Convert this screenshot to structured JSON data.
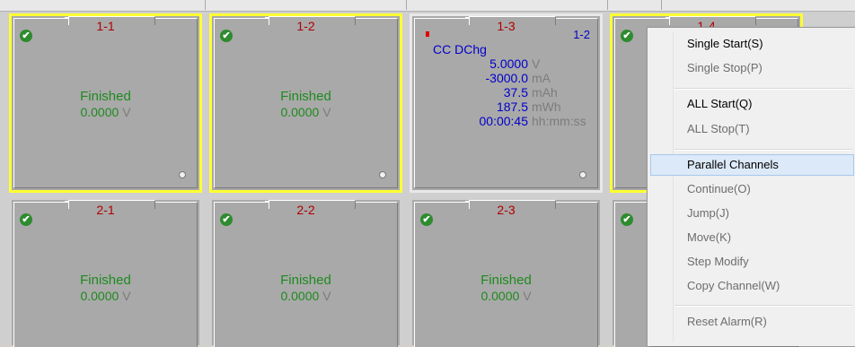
{
  "channels_row1": [
    {
      "id": "1-1",
      "status": "Finished",
      "voltage": "0.0000",
      "unit": "V"
    },
    {
      "id": "1-2",
      "status": "Finished",
      "voltage": "0.0000",
      "unit": "V"
    },
    {
      "id": "1-3",
      "group": "1-2",
      "mode": "CC  DChg",
      "readings": [
        {
          "value": "5.0000",
          "unit": "V"
        },
        {
          "value": "-3000.0",
          "unit": "mA"
        },
        {
          "value": "37.5",
          "unit": "mAh"
        },
        {
          "value": "187.5",
          "unit": "mWh"
        },
        {
          "value": "00:00:45",
          "unit": "hh:mm:ss"
        }
      ]
    },
    {
      "id": "1-4"
    }
  ],
  "channels_row2": [
    {
      "id": "2-1",
      "status": "Finished",
      "voltage": "0.0000",
      "unit": "V"
    },
    {
      "id": "2-2",
      "status": "Finished",
      "voltage": "0.0000",
      "unit": "V"
    },
    {
      "id": "2-3",
      "status": "Finished",
      "voltage": "0.0000",
      "unit": "V"
    }
  ],
  "icons": {
    "check": "✔"
  },
  "context_menu": {
    "items": [
      {
        "label": "Single Start(S)",
        "enabled": true
      },
      {
        "label": "Single Stop(P)",
        "enabled": false
      },
      {
        "label": "ALL Start(Q)",
        "enabled": true
      },
      {
        "label": "ALL Stop(T)",
        "enabled": false
      },
      {
        "label": "Parallel Channels",
        "enabled": true,
        "highlighted": true
      },
      {
        "label": "Continue(O)",
        "enabled": false
      },
      {
        "label": "Jump(J)",
        "enabled": false
      },
      {
        "label": "Move(K)",
        "enabled": false
      },
      {
        "label": "Step Modify",
        "enabled": false
      },
      {
        "label": "Copy Channel(W)",
        "enabled": false
      },
      {
        "label": "Reset Alarm(R)",
        "enabled": false
      }
    ]
  },
  "colors": {
    "selected_border": "#ffff33",
    "finished_text": "#1e8a1e",
    "value_text": "#0000cc",
    "id_text": "#b00000"
  }
}
